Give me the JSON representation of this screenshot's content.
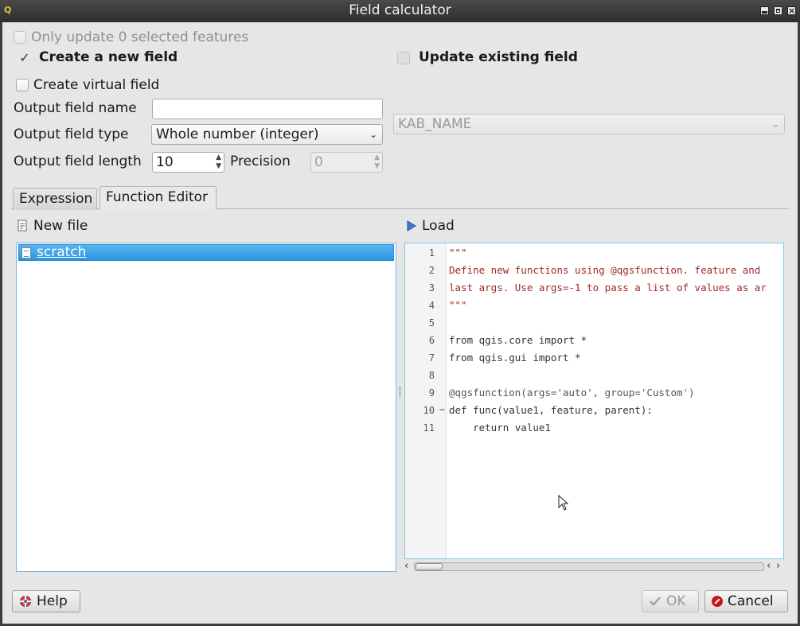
{
  "window": {
    "title": "Field calculator",
    "close_glyph": "×"
  },
  "options": {
    "only_update_selected": "Only update 0 selected features",
    "create_new_field": "Create a new field",
    "update_existing_field": "Update existing field",
    "create_virtual_field": "Create virtual field",
    "checked_glyph": "✓"
  },
  "form": {
    "output_field_name_label": "Output field name",
    "output_field_name_value": "",
    "output_field_type_label": "Output field type",
    "output_field_type_value": "Whole number (integer)",
    "output_field_length_label": "Output field length",
    "output_field_length_value": "10",
    "precision_label": "Precision",
    "precision_value": "0",
    "existing_field_value": "KAB_NAME"
  },
  "tabs": {
    "expression": "Expression",
    "function_editor": "Function Editor"
  },
  "function_editor": {
    "new_file_label": "New file",
    "load_label": "Load",
    "files": [
      "scratch"
    ],
    "line_numbers": [
      "1",
      "2",
      "3",
      "4",
      "5",
      "6",
      "7",
      "8",
      "9",
      "10",
      "11"
    ],
    "code_lines": [
      "\"\"\"",
      "Define new functions using @qgsfunction. feature and",
      "last args. Use args=-1 to pass a list of values as ar",
      "\"\"\"",
      "",
      "from qgis.core import *",
      "from qgis.gui import *",
      "",
      "@qgsfunction(args='auto', group='Custom')",
      "def func(value1, feature, parent):",
      "    return value1"
    ]
  },
  "buttons": {
    "help": "Help",
    "ok": "OK",
    "cancel": "Cancel"
  },
  "colors": {
    "selection": "#3a9fe6",
    "string": "#a02828",
    "keyword": "#1a7a1a",
    "cancel": "#c4161c"
  }
}
